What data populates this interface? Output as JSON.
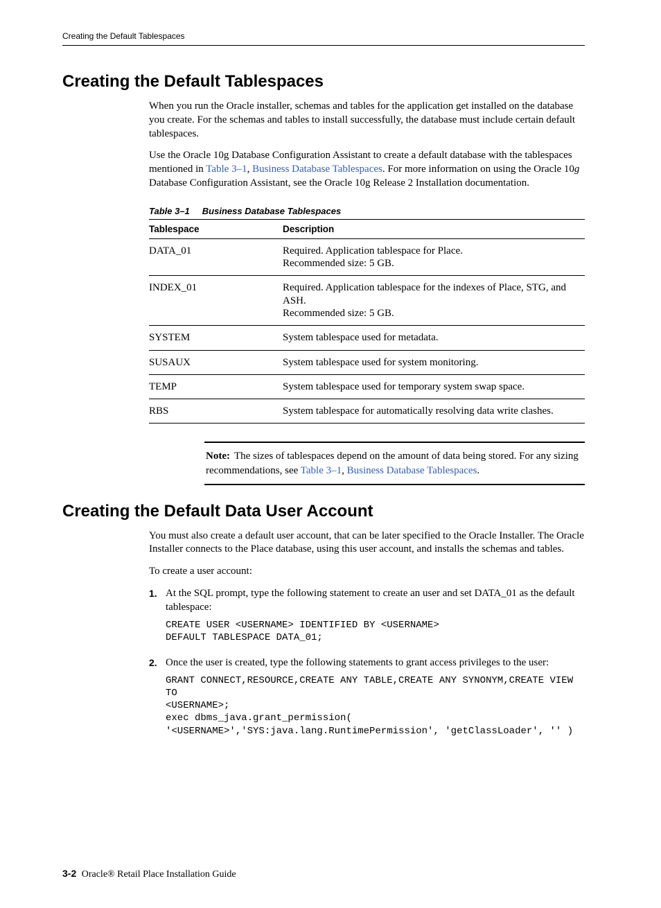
{
  "header": {
    "running": "Creating the Default Tablespaces"
  },
  "section1": {
    "title": "Creating the Default Tablespaces",
    "p1": "When you run the Oracle installer, schemas and tables for the application get installed on the database you create. For the schemas and tables to install successfully, the database must include certain default tablespaces.",
    "p2_a": "Use the Oracle 10g Database Configuration Assistant to create a default database with the tablespaces mentioned in ",
    "p2_link1": "Table 3–1",
    "p2_comma": ",  ",
    "p2_link2": "Business Database Tablespaces",
    "p2_b": ". For more information on using the Oracle 10",
    "p2_italic": "g",
    "p2_c": " Database Configuration Assistant, see the Oracle 10g Release 2 Installation documentation.",
    "tableCaptionNum": "Table 3–1",
    "tableCaptionTitle": "Business Database Tablespaces",
    "tableHeaders": {
      "c1": "Tablespace",
      "c2": "Description"
    },
    "rows": [
      {
        "ts": "DATA_01",
        "desc": "Required. Application tablespace for Place.\nRecommended size: 5 GB."
      },
      {
        "ts": "INDEX_01",
        "desc": "Required. Application tablespace for the indexes of Place, STG, and ASH.\nRecommended size: 5 GB."
      },
      {
        "ts": "SYSTEM",
        "desc": "System tablespace used for metadata."
      },
      {
        "ts": "SUSAUX",
        "desc": "System tablespace used for system monitoring."
      },
      {
        "ts": "TEMP",
        "desc": "System tablespace used for temporary system swap space."
      },
      {
        "ts": "RBS",
        "desc": "System tablespace for automatically resolving data write clashes."
      }
    ],
    "noteLabel": "Note:",
    "note_a": "The sizes of tablespaces depend on the amount of data being stored. For any sizing recommendations, see ",
    "note_link1": "Table 3–1",
    "note_comma": ",  ",
    "note_link2": "Business Database Tablespaces",
    "note_b": "."
  },
  "section2": {
    "title": "Creating the Default Data User Account",
    "p1": "You must also create a default user account, that can be later specified to the Oracle Installer. The Oracle Installer connects to the Place database, using this user account, and installs the schemas and tables.",
    "p2": "To create a user account:",
    "steps": [
      {
        "num": "1.",
        "text": "At the SQL prompt, type the following statement to create an user and set DATA_01 as the default tablespace:",
        "code": "CREATE USER <USERNAME> IDENTIFIED BY <USERNAME>\nDEFAULT TABLESPACE DATA_01;"
      },
      {
        "num": "2.",
        "text": "Once the user is created, type the following statements to grant access privileges to the user:",
        "code": "GRANT CONNECT,RESOURCE,CREATE ANY TABLE,CREATE ANY SYNONYM,CREATE VIEW TO\n<USERNAME>;\nexec dbms_java.grant_permission(\n'<USERNAME>','SYS:java.lang.RuntimePermission', 'getClassLoader', '' )"
      }
    ]
  },
  "footer": {
    "pageNum": "3-2",
    "bookTitle": "Oracle® Retail Place Installation Guide"
  }
}
